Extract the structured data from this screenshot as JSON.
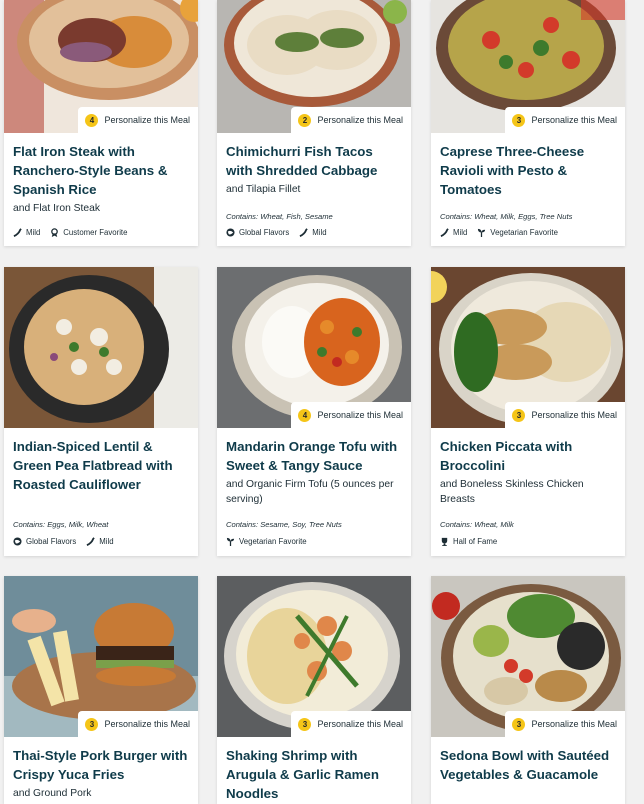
{
  "colors": {
    "accent_yellow": "#f5c518",
    "title_navy": "#0f3b4a",
    "text": "#1d2d35"
  },
  "cards": [
    {
      "title": "Flat Iron Steak with Ranchero-Style Beans & Spanish Rice",
      "subtitle": "and Flat Iron Steak",
      "contains": "",
      "personalize_count": "4",
      "personalize_label": "Personalize this Meal",
      "tags": [
        {
          "icon": "pepper-icon",
          "label": "Mild"
        },
        {
          "icon": "award-icon",
          "label": "Customer Favorite"
        }
      ]
    },
    {
      "title": "Chimichurri Fish Tacos with Shredded Cabbage",
      "subtitle": "and Tilapia Fillet",
      "contains": "Contains: Wheat, Fish, Sesame",
      "personalize_count": "2",
      "personalize_label": "Personalize this Meal",
      "tags": [
        {
          "icon": "globe-icon",
          "label": "Global Flavors"
        },
        {
          "icon": "pepper-icon",
          "label": "Mild"
        }
      ]
    },
    {
      "title": "Caprese Three-Cheese Ravioli with Pesto & Tomatoes",
      "subtitle": "",
      "contains": "Contains: Wheat, Milk, Eggs, Tree Nuts",
      "personalize_count": "3",
      "personalize_label": "Personalize this Meal",
      "tags": [
        {
          "icon": "pepper-icon",
          "label": "Mild"
        },
        {
          "icon": "sprout-icon",
          "label": "Vegetarian Favorite"
        }
      ]
    },
    {
      "title": "Indian-Spiced Lentil & Green Pea Flatbread with Roasted Cauliflower",
      "subtitle": "",
      "contains": "Contains: Eggs, Milk, Wheat",
      "personalize_count": "",
      "personalize_label": "",
      "tags": [
        {
          "icon": "globe-icon",
          "label": "Global Flavors"
        },
        {
          "icon": "pepper-icon",
          "label": "Mild"
        }
      ]
    },
    {
      "title": "Mandarin Orange Tofu with Sweet & Tangy Sauce",
      "subtitle": "and Organic Firm Tofu (5 ounces per serving)",
      "contains": "Contains: Sesame, Soy, Tree Nuts",
      "personalize_count": "4",
      "personalize_label": "Personalize this Meal",
      "tags": [
        {
          "icon": "sprout-icon",
          "label": "Vegetarian Favorite"
        }
      ]
    },
    {
      "title": "Chicken Piccata with Broccolini",
      "subtitle": "and Boneless Skinless Chicken Breasts",
      "contains": "Contains: Wheat, Milk",
      "personalize_count": "3",
      "personalize_label": "Personalize this Meal",
      "tags": [
        {
          "icon": "trophy-icon",
          "label": "Hall of Fame"
        }
      ]
    },
    {
      "title": "Thai-Style Pork Burger with Crispy Yuca Fries",
      "subtitle": "and Ground Pork",
      "contains": "",
      "personalize_count": "3",
      "personalize_label": "Personalize this Meal",
      "tags": []
    },
    {
      "title": "Shaking Shrimp with Arugula & Garlic Ramen Noodles",
      "subtitle": "",
      "contains": "",
      "personalize_count": "3",
      "personalize_label": "Personalize this Meal",
      "tags": []
    },
    {
      "title": "Sedona Bowl with Sautéed Vegetables & Guacamole",
      "subtitle": "",
      "contains": "",
      "personalize_count": "3",
      "personalize_label": "Personalize this Meal",
      "tags": []
    }
  ]
}
